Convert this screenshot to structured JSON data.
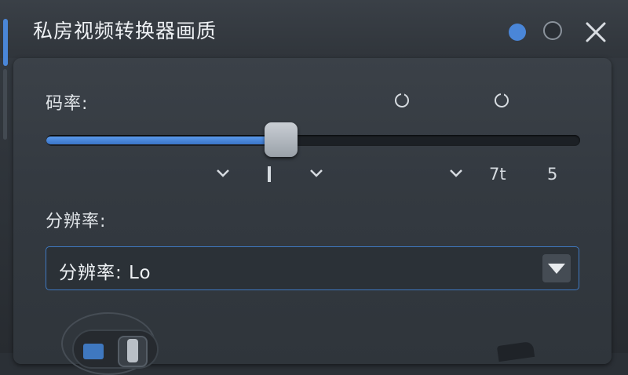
{
  "window": {
    "title": "私房视频转换器画质"
  },
  "bitrate": {
    "label": "码率:",
    "value_fraction": 0.44,
    "tick_labels": [
      "7t",
      "5"
    ]
  },
  "resolution": {
    "label": "分辨率:",
    "select_value": "分辨率: Lo"
  },
  "colors": {
    "accent": "#4a86d8",
    "background": "#2b3036"
  },
  "icons": [
    "dot-blue",
    "dot-ring",
    "close-icon",
    "ring-mark",
    "chevron-down-icon",
    "dropdown-triangle-icon",
    "checkbox-icon",
    "toggle-icon"
  ]
}
